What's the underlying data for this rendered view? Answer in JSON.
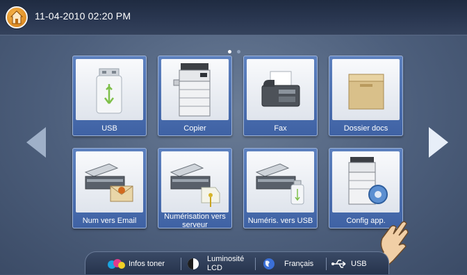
{
  "header": {
    "datetime": "11-04-2010 02:20 PM"
  },
  "pager": {
    "pages": 2,
    "current": 1
  },
  "tiles": [
    {
      "label": "USB",
      "icon": "usb-drive-icon"
    },
    {
      "label": "Copier",
      "icon": "copier-icon"
    },
    {
      "label": "Fax",
      "icon": "fax-icon"
    },
    {
      "label": "Dossier docs",
      "icon": "document-box-icon"
    },
    {
      "label": "Num vers Email",
      "icon": "scan-to-email-icon"
    },
    {
      "label": "Numérisation vers serveur",
      "icon": "scan-to-server-icon"
    },
    {
      "label": "Numéris. vers USB",
      "icon": "scan-to-usb-icon"
    },
    {
      "label": "Config app.",
      "icon": "machine-setup-icon"
    }
  ],
  "bottombar": {
    "toner": "Infos toner",
    "brightness_line1": "Luminosité",
    "brightness_line2": "LCD",
    "language": "Français",
    "usb": "USB"
  },
  "colors": {
    "tile_blue": "#4a6fb0",
    "home_orange": "#e08a1e",
    "topbar": "#26334c"
  }
}
